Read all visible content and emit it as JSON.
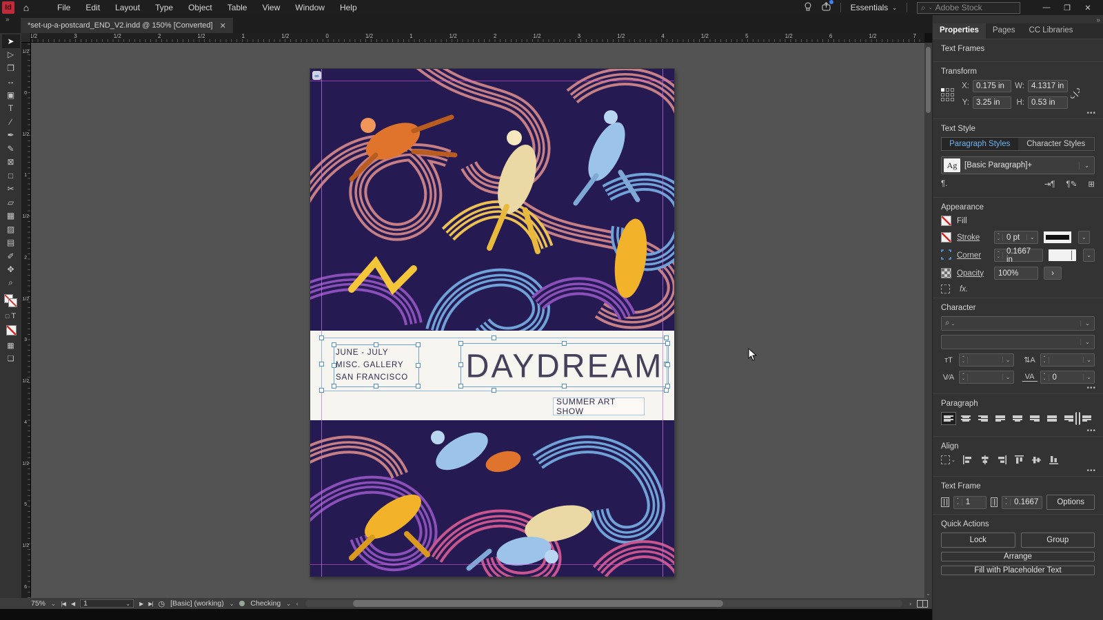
{
  "app": {
    "menu": [
      "File",
      "Edit",
      "Layout",
      "Type",
      "Object",
      "Table",
      "View",
      "Window",
      "Help"
    ],
    "workspace_label": "Essentials",
    "search_placeholder": "Adobe Stock",
    "doc_tab_title": "*set-up-a-postcard_END_V2.indd @ 150% [Converted]",
    "accent_blue": "#6fb3f2",
    "selection_blue": "#4f8fde"
  },
  "tools": [
    {
      "name": "selection-tool",
      "glyph": "➤",
      "active": true
    },
    {
      "name": "direct-selection-tool",
      "glyph": "▷"
    },
    {
      "name": "page-tool",
      "glyph": "❐"
    },
    {
      "name": "gap-tool",
      "glyph": "↔"
    },
    {
      "name": "content-collector-tool",
      "glyph": "▣"
    },
    {
      "name": "type-tool",
      "glyph": "T"
    },
    {
      "name": "line-tool",
      "glyph": "∕"
    },
    {
      "name": "pen-tool",
      "glyph": "✒"
    },
    {
      "name": "pencil-tool",
      "glyph": "✎"
    },
    {
      "name": "frame-tool",
      "glyph": "⊠"
    },
    {
      "name": "rectangle-tool",
      "glyph": "□"
    },
    {
      "name": "scissors-tool",
      "glyph": "✂"
    },
    {
      "name": "free-transform-tool",
      "glyph": "▱"
    },
    {
      "name": "gradient-tool",
      "glyph": "▦"
    },
    {
      "name": "gradient-feather-tool",
      "glyph": "▨"
    },
    {
      "name": "note-tool",
      "glyph": "▤"
    },
    {
      "name": "eyedropper-tool",
      "glyph": "✐"
    },
    {
      "name": "hand-tool",
      "glyph": "✥"
    },
    {
      "name": "zoom-tool",
      "glyph": "⌕"
    }
  ],
  "rulers": {
    "horizontal": [
      "1/2",
      "3",
      "1/2",
      "2",
      "1/2",
      "1",
      "1/2",
      "0",
      "1/2",
      "1",
      "1/2",
      "2",
      "1/2",
      "3",
      "1/2",
      "4",
      "1/2",
      "5",
      "1/2",
      "6",
      "1/2",
      "7"
    ],
    "vertical": [
      "1/2",
      "0",
      "1/2",
      "1",
      "1/2",
      "2",
      "1/2",
      "3",
      "1/2",
      "4",
      "1/2",
      "5",
      "1/2",
      "6"
    ]
  },
  "canvas": {
    "postcard": {
      "dates": "JUNE - JULY",
      "gallery": "MISC. GALLERY",
      "city": "SAN FRANCISCO",
      "title": "DAYDREAM",
      "banner": "SUMMER ART SHOW"
    }
  },
  "panel": {
    "tabs": [
      {
        "label": "Properties",
        "active": true
      },
      {
        "label": "Pages"
      },
      {
        "label": "CC Libraries"
      }
    ],
    "selection_type": "Text Frames",
    "transform": {
      "label": "Transform",
      "x_label": "X:",
      "x": "0.175 in",
      "y_label": "Y:",
      "y": "3.25 in",
      "w_label": "W:",
      "w": "4.1317 in",
      "h_label": "H:",
      "h": "0.53 in"
    },
    "text_style": {
      "label": "Text Style",
      "paragraph_tab": "Paragraph Styles",
      "character_tab": "Character Styles",
      "sample_badge": "Ag",
      "style_name": "[Basic Paragraph]+"
    },
    "appearance": {
      "label": "Appearance",
      "fill_label": "Fill",
      "stroke_label": "Stroke",
      "stroke_value": "0 pt",
      "corner_label": "Corner",
      "corner_value": "0.1667 in",
      "opacity_label": "Opacity",
      "opacity_value": "100%",
      "fx_label": "fx."
    },
    "character": {
      "label": "Character",
      "tracking_value": "0"
    },
    "paragraph": {
      "label": "Paragraph",
      "buttons": [
        {
          "name": "align-left",
          "variant": "left",
          "active": true
        },
        {
          "name": "align-center",
          "variant": "center"
        },
        {
          "name": "align-right",
          "variant": "right"
        },
        {
          "name": "justify-last-left",
          "variant": "jl"
        },
        {
          "name": "justify-last-center",
          "variant": "jc"
        },
        {
          "name": "justify-last-right",
          "variant": "jr"
        },
        {
          "name": "justify-all",
          "variant": "ja"
        },
        {
          "name": "align-towards-spine",
          "variant": "spine"
        },
        {
          "name": "align-away-from-spine",
          "variant": "away"
        }
      ]
    },
    "align": {
      "label": "Align"
    },
    "text_frame": {
      "label": "Text Frame",
      "columns": "1",
      "gutter": "0.1667",
      "options_label": "Options"
    },
    "quick_actions": {
      "label": "Quick Actions",
      "lock": "Lock",
      "group": "Group",
      "arrange": "Arrange",
      "placeholder": "Fill with Placeholder Text"
    }
  },
  "statusbar": {
    "zoom": "75%",
    "page": "1",
    "preset": "[Basic] (working)",
    "status": "Checking"
  }
}
